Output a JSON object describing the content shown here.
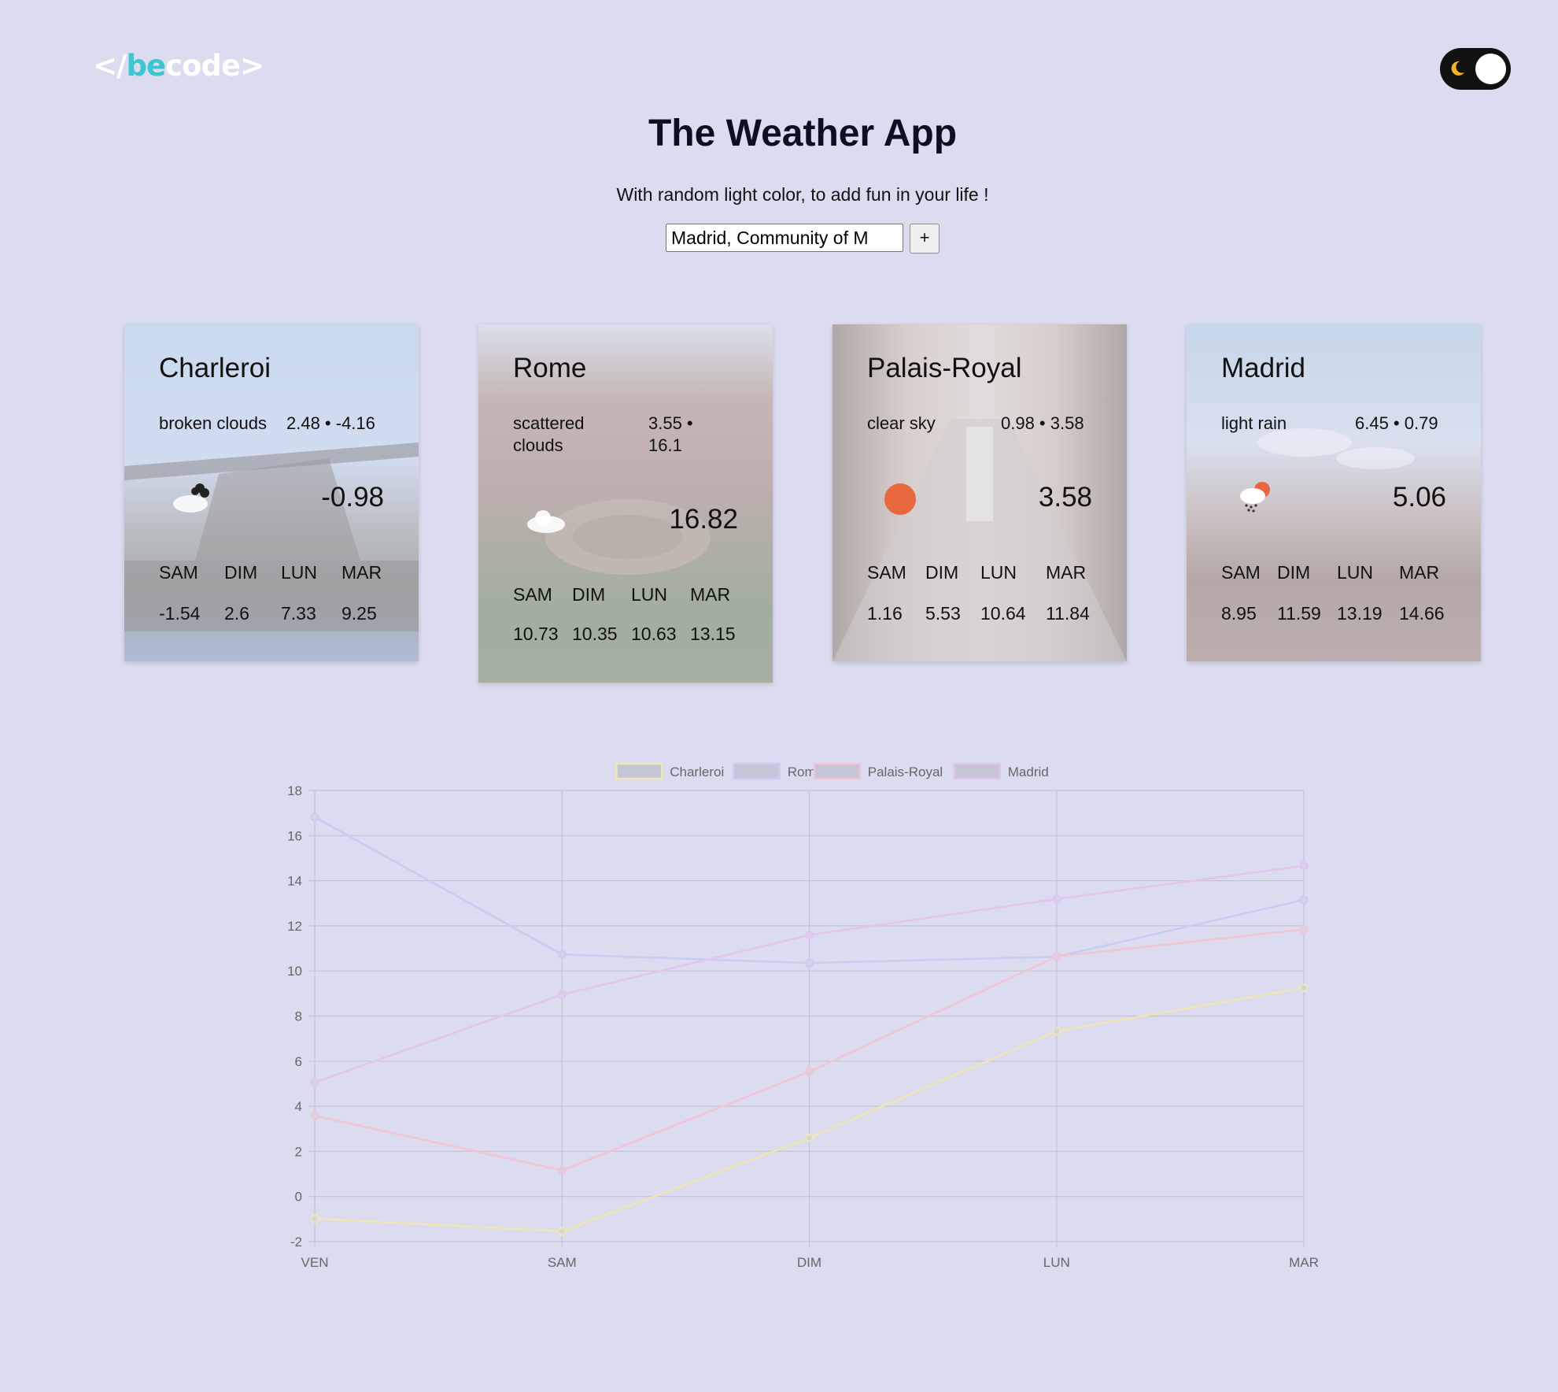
{
  "header": {
    "logo_prefix": "</",
    "logo_be": "be",
    "logo_code": "code",
    "logo_suffix": ">",
    "title": "The Weather App",
    "subtitle": "With random light color, to add fun in your life !"
  },
  "theme_toggle": {
    "icon": "moon-icon",
    "state": "light"
  },
  "search": {
    "value": "Madrid, Community of M",
    "add_label": "+"
  },
  "cards": [
    {
      "city": "Charleroi",
      "description": "broken clouds",
      "range": "2.48 • -4.16",
      "temp": "-0.98",
      "icon": "broken-clouds-icon",
      "days": [
        "SAM",
        "DIM",
        "LUN",
        "MAR"
      ],
      "values": [
        "-1.54",
        "2.6",
        "7.33",
        "9.25"
      ]
    },
    {
      "city": "Rome",
      "description": "scattered clouds",
      "range": "3.55 • 16.1",
      "temp": "16.82",
      "icon": "scattered-clouds-icon",
      "days": [
        "SAM",
        "DIM",
        "LUN",
        "MAR"
      ],
      "values": [
        "10.73",
        "10.35",
        "10.63",
        "13.15"
      ]
    },
    {
      "city": "Palais-Royal",
      "description": "clear sky",
      "range": "0.98 • 3.58",
      "temp": "3.58",
      "icon": "sun-icon",
      "days": [
        "SAM",
        "DIM",
        "LUN",
        "MAR"
      ],
      "values": [
        "1.16",
        "5.53",
        "10.64",
        "11.84"
      ]
    },
    {
      "city": "Madrid",
      "description": "light rain",
      "range": "6.45 • 0.79",
      "temp": "5.06",
      "icon": "light-rain-icon",
      "days": [
        "SAM",
        "DIM",
        "LUN",
        "MAR"
      ],
      "values": [
        "8.95",
        "11.59",
        "13.19",
        "14.66"
      ]
    }
  ],
  "chart_data": {
    "type": "line",
    "categories": [
      "VEN",
      "SAM",
      "DIM",
      "LUN",
      "MAR"
    ],
    "ylim": [
      -2,
      18
    ],
    "yticks": [
      18,
      16,
      14,
      12,
      10,
      8,
      6,
      4,
      2,
      0,
      -2
    ],
    "grid": true,
    "legend_position": "top",
    "series": [
      {
        "name": "Charleroi",
        "color": "#ece7b4",
        "values": [
          -0.98,
          -1.54,
          2.6,
          7.33,
          9.25
        ]
      },
      {
        "name": "Rome",
        "color": "#c6cdf0",
        "values": [
          16.82,
          10.73,
          10.35,
          10.63,
          13.15
        ]
      },
      {
        "name": "Palais-Royal",
        "color": "#f1c5d3",
        "values": [
          3.58,
          1.16,
          5.53,
          10.64,
          11.84
        ]
      },
      {
        "name": "Madrid",
        "color": "#e3c4ef",
        "values": [
          5.06,
          8.95,
          11.59,
          13.19,
          14.66
        ]
      }
    ]
  }
}
